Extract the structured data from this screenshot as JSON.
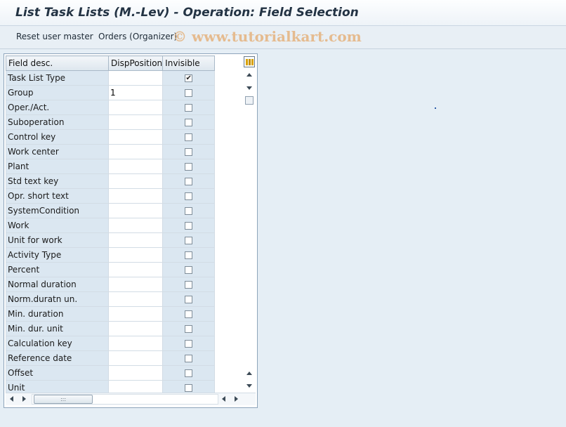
{
  "title": "List Task Lists (M.-Lev) - Operation: Field Selection",
  "toolbar": {
    "reset_label": "Reset user master",
    "orders_label": "Orders (Organizer)"
  },
  "watermark": "© www.tutorialkart.com",
  "table": {
    "columns": [
      "Field desc.",
      "DispPosition",
      "Invisible"
    ],
    "rows": [
      {
        "desc": "Task List Type",
        "pos": "",
        "invisible": true
      },
      {
        "desc": "Group",
        "pos": "1",
        "invisible": false
      },
      {
        "desc": "Oper./Act.",
        "pos": "",
        "invisible": false
      },
      {
        "desc": "Suboperation",
        "pos": "",
        "invisible": false
      },
      {
        "desc": "Control key",
        "pos": "",
        "invisible": false
      },
      {
        "desc": "Work center",
        "pos": "",
        "invisible": false
      },
      {
        "desc": "Plant",
        "pos": "",
        "invisible": false
      },
      {
        "desc": "Std text key",
        "pos": "",
        "invisible": false
      },
      {
        "desc": "Opr. short text",
        "pos": "",
        "invisible": false
      },
      {
        "desc": "SystemCondition",
        "pos": "",
        "invisible": false
      },
      {
        "desc": "Work",
        "pos": "",
        "invisible": false
      },
      {
        "desc": "Unit for work",
        "pos": "",
        "invisible": false
      },
      {
        "desc": "Activity Type",
        "pos": "",
        "invisible": false
      },
      {
        "desc": "Percent",
        "pos": "",
        "invisible": false
      },
      {
        "desc": "Normal duration",
        "pos": "",
        "invisible": false
      },
      {
        "desc": "Norm.duratn un.",
        "pos": "",
        "invisible": false
      },
      {
        "desc": "Min. duration",
        "pos": "",
        "invisible": false
      },
      {
        "desc": "Min. dur. unit",
        "pos": "",
        "invisible": false
      },
      {
        "desc": "Calculation key",
        "pos": "",
        "invisible": false
      },
      {
        "desc": "Reference date",
        "pos": "",
        "invisible": false
      },
      {
        "desc": "Offset",
        "pos": "",
        "invisible": false
      },
      {
        "desc": "Unit",
        "pos": "",
        "invisible": false
      }
    ]
  },
  "hscroll_grip": ":::",
  "icons": {
    "config": "column-config-icon",
    "scroll_up": "scroll-up-icon",
    "scroll_down": "scroll-down-icon",
    "scroll_left": "scroll-left-icon",
    "scroll_right": "scroll-right-icon"
  }
}
